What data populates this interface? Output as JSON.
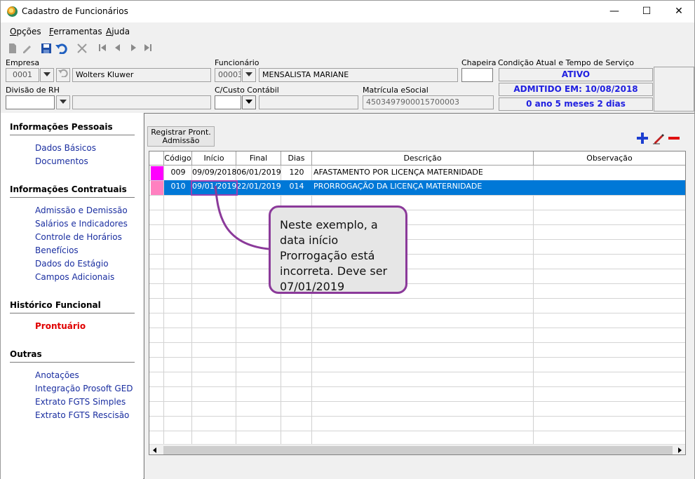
{
  "window": {
    "title": "Cadastro de Funcionários",
    "minimize": "—",
    "maximize": "☐",
    "close": "✕"
  },
  "menu": [
    {
      "label": "Opções",
      "key": "O",
      "rest": "pções"
    },
    {
      "label": "Ferramentas",
      "key": "F",
      "rest": "erramentas"
    },
    {
      "label": "Ajuda",
      "key": "A",
      "rest": "juda"
    }
  ],
  "toolbar": [
    "new-icon",
    "edit-icon",
    "save-icon",
    "undo-icon",
    "cancel-icon",
    "first-icon",
    "prev-icon",
    "next-icon",
    "last-icon"
  ],
  "header": {
    "empresa_label": "Empresa",
    "empresa_code": "0001",
    "empresa_name": "Wolters Kluwer",
    "funcionario_label": "Funcionário",
    "funcionario_code": "00003",
    "funcionario_name": "MENSALISTA MARIANE",
    "chapeira_label": "Chapeira",
    "chapeira_value": "",
    "condicao_label": "Condição Atual e Tempo de Serviço",
    "status1": "ATIVO",
    "status2": "ADMITIDO EM: 10/08/2018",
    "status3": "0 ano 5 meses 2 dias",
    "divisao_label": "Divisão de RH",
    "divisao_code": "",
    "divisao_name": "",
    "custo_label": "C/Custo Contábil",
    "custo_code": "",
    "custo_name": "",
    "esocial_label": "Matrícula eSocial",
    "esocial_value": "4503497900015700003"
  },
  "sidebar": {
    "sec1": "Informações Pessoais",
    "sec1_items": [
      "Dados Básicos",
      "Documentos"
    ],
    "sec2": "Informações Contratuais",
    "sec2_items": [
      "Admissão e Demissão",
      "Salários e Indicadores",
      "Controle de Horários",
      "Benefícios",
      "Dados do Estágio",
      "Campos Adicionais"
    ],
    "sec3": "Histórico Funcional",
    "sec3_items": [
      "Prontuário"
    ],
    "sec4": "Outras",
    "sec4_items": [
      "Anotações",
      "Integração Prosoft GED",
      "Extrato FGTS Simples",
      "Extrato FGTS Rescisão"
    ]
  },
  "content": {
    "register_button": "Registrar Pront. Admissão",
    "register_line1": "Registrar Pront.",
    "register_line2": "Admissão",
    "columns": [
      "Código",
      "Início",
      "Final",
      "Dias",
      "Descrição",
      "Observação"
    ],
    "rows": [
      {
        "color": "#ff00ff",
        "codigo": "009",
        "inicio": "09/09/2018",
        "final": "06/01/2019",
        "dias": "120",
        "descricao": "AFASTAMENTO POR LICENÇA MATERNIDADE",
        "observacao": ""
      },
      {
        "color": "#ff80c0",
        "codigo": "010",
        "inicio": "09/01/2019",
        "final": "22/01/2019",
        "dias": "014",
        "descricao": "PRORROGAÇÃO DA LICENÇA MATERNIDADE",
        "observacao": ""
      }
    ]
  },
  "callout": "Neste exemplo, a data início Prorrogação está incorreta. Deve ser 07/01/2019",
  "colors": {
    "selection": "#0078d7",
    "link": "#1a2ea0",
    "active_link": "#e00000",
    "callout_border": "#8b3a9a",
    "status_text": "#2020e0"
  }
}
